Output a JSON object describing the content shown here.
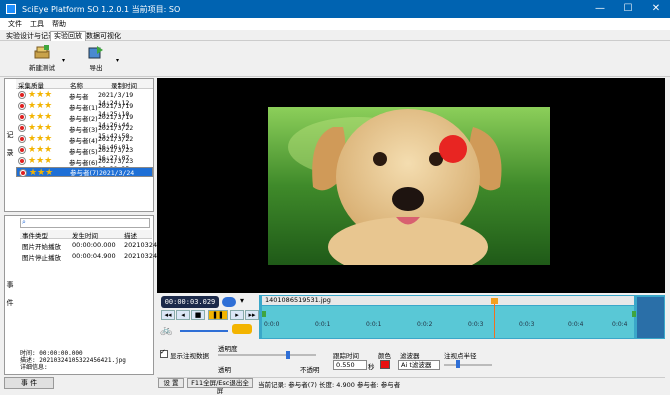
{
  "window": {
    "title": "SciEye Platform SO 1.2.0.1   当前项目: SO",
    "minimize": "—",
    "maximize": "☐",
    "close": "✕"
  },
  "menu": [
    "文件",
    "工具",
    "帮助"
  ],
  "tabs": [
    "实验设计与记录",
    "实验回放",
    "数据可视化"
  ],
  "toolbar": {
    "new_test": "新建测试",
    "export": "导出"
  },
  "records": {
    "side_label_1": "记",
    "side_label_2": "录",
    "headers": [
      "采集质量",
      "名称",
      "录制时间"
    ],
    "rows": [
      {
        "stars": "★★★",
        "name": "参与者",
        "time": "2021/3/19 14:24:12"
      },
      {
        "stars": "★★★",
        "name": "参与者(1)",
        "time": "2021/3/19 14:25:10"
      },
      {
        "stars": "★★★",
        "name": "参与者(2)",
        "time": "2021/3/19 14:26:44"
      },
      {
        "stars": "★★★",
        "name": "参与者(3)",
        "time": "2021/3/22 15:42:50"
      },
      {
        "stars": "★★★",
        "name": "参与者(4)",
        "time": "2021/3/22 16:46:01"
      },
      {
        "stars": "★★★",
        "name": "参与者(5)",
        "time": "2021/3/23 16:27:07"
      },
      {
        "stars": "★★★",
        "name": "参与者(6)",
        "time": "2021/3/23 16:38:35"
      },
      {
        "stars": "★★★",
        "name": "参与者(7)",
        "time": "2021/3/24 10:53:05"
      }
    ]
  },
  "events": {
    "side_label_1": "事",
    "side_label_2": "件",
    "headers": [
      "事件类型",
      "发生时间",
      "描述"
    ],
    "rows": [
      {
        "type": "图片开始播放",
        "time": "00:00:00.000",
        "desc": "2021032415"
      },
      {
        "type": "图片停止播放",
        "time": "00:00:04.900",
        "desc": "2021032415"
      }
    ],
    "info_time": "时间: 00:00:00.000",
    "info_desc": "描述: 20210324105322456421.jpg",
    "info_detail": "详细信息:",
    "bottom_tab": "事 件"
  },
  "player": {
    "time": "00:00:03.029",
    "file": "1401086519531.jpg",
    "ticks": [
      "0:0:0",
      "0:0:1",
      "0:0:1",
      "0:0:2",
      "0:0:3",
      "0:0:3",
      "0:0:4",
      "0:0:4"
    ]
  },
  "settings": {
    "show_gaze": "显示注视数据",
    "opacity": "透明度",
    "transparent": "透明",
    "opaque": "不透明",
    "follow_time": "跟踪时间",
    "follow_value": "0.550",
    "seconds": "秒",
    "color": "颜色",
    "color_value": "#e81010",
    "filter": "滤波器",
    "filter_value": "Ai t滤波器",
    "gaze_radius": "注视点半径"
  },
  "status": {
    "settings_btn": "设 置",
    "fullscreen_btn": "F11全屏/Esc退出全屏",
    "current": "当前记录: 参与者(7)  长度: 4.900  参与者: 参与者"
  }
}
